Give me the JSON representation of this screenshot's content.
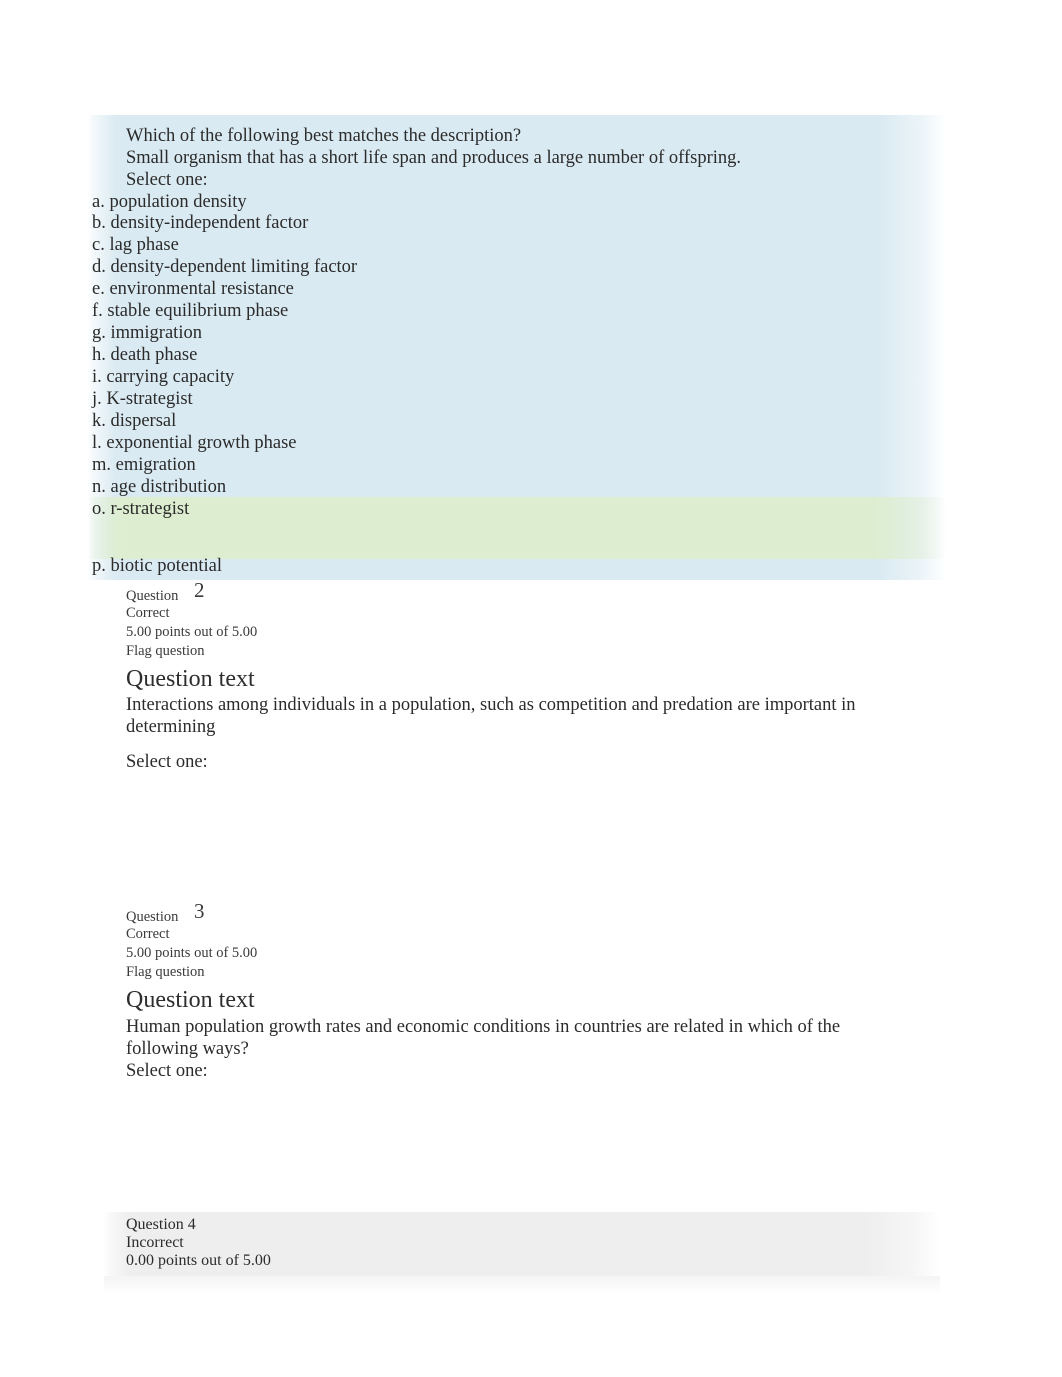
{
  "colors": {
    "question_highlight_blue": "#daeaf2",
    "correct_answer_green": "#ddeed0",
    "question_meta_gray": "#eeeeee",
    "text": "#2b2b2b"
  },
  "question1": {
    "prompt_line1": "Which of the following best matches the description?",
    "prompt_line2": "Small organism that has a short life span and produces a large number of offspring.",
    "select_one": "Select one:",
    "options": [
      "a. population density",
      "b. density-independent factor",
      "c. lag phase",
      "d. density-dependent limiting factor",
      "e. environmental resistance",
      "f. stable equilibrium phase",
      "g. immigration",
      "h. death phase",
      "i. carrying capacity",
      "j. K-strategist",
      "k. dispersal",
      "l. exponential growth phase",
      "m. emigration",
      "n. age distribution",
      "o. r-strategist",
      "p. biotic potential"
    ]
  },
  "question2": {
    "question_label": "Question",
    "number": "2",
    "state": "Correct",
    "points": "5.00 points out of 5.00",
    "flag_label": "Flag question",
    "heading": "Question text",
    "body": "Interactions among individuals in a population, such as competition and predation are important in determining",
    "select_one": "Select one:"
  },
  "question3": {
    "question_label": "Question",
    "number": "3",
    "state": "Correct",
    "points": "5.00 points out of 5.00",
    "flag_label": "Flag question",
    "heading": "Question text",
    "body": "Human population growth rates and economic conditions in countries are related in which of the following ways?",
    "select_one": "Select one:"
  },
  "question4": {
    "question_label": "Question",
    "number": "4",
    "state": "Incorrect",
    "points": "0.00 points out of 5.00"
  }
}
